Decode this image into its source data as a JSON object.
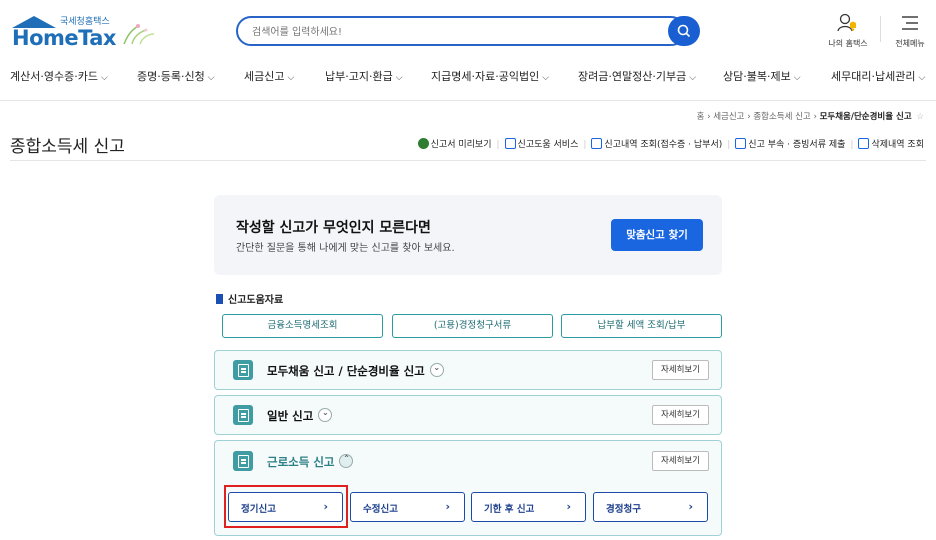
{
  "header": {
    "logo_sub": "국세청홈택스",
    "logo_brand": "HomeTax",
    "search_placeholder": "검색어를 입력하세요!",
    "my_hometax": "나의 홈택스",
    "all_menu": "전체메뉴"
  },
  "nav": [
    {
      "label": "계산서·영수증·카드"
    },
    {
      "label": "증명·등록·신청"
    },
    {
      "label": "세금신고"
    },
    {
      "label": "납부·고지·환급"
    },
    {
      "label": "지급명세·자료·공익법인"
    },
    {
      "label": "장려금·연말정산·기부금"
    },
    {
      "label": "상담·불복·제보"
    },
    {
      "label": "세무대리·납세관리"
    }
  ],
  "breadcrumb": {
    "home": "홈",
    "level1": "세금신고",
    "level2": "종합소득세 신고",
    "current": "모두채움/단순경비율 신고"
  },
  "page_title": "종합소득세 신고",
  "util_links": {
    "preview": "신고서 미리보기",
    "help_service": "신고도움 서비스",
    "history": "신고내역 조회(접수증 · 납부서)",
    "attach": "신고 부속 · 증빙서류 제출",
    "deleted": "삭제내역 조회"
  },
  "guide": {
    "title": "작성할 신고가 무엇인지 모른다면",
    "desc": "간단한 질문을 통해 나에게 맞는 신고를 찾아 보세요.",
    "button": "맞춤신고 찾기"
  },
  "help_section": {
    "heading": "신고도움자료",
    "buttons": [
      "금융소득명세조회",
      "(고용)경정청구서류",
      "납부할 세액 조회/납부"
    ]
  },
  "accordions": [
    {
      "title": "모두채움 신고 / 단순경비율 신고",
      "toggle": "⌄",
      "detail": "자세히보기"
    },
    {
      "title": "일반 신고",
      "toggle": "⌄",
      "detail": "자세히보기"
    },
    {
      "title": "근로소득 신고",
      "toggle": "⌃",
      "detail": "자세히보기"
    }
  ],
  "sub_buttons": [
    "정기신고",
    "수정신고",
    "기한 후 신고",
    "경정청구"
  ],
  "colors": {
    "brand": "#1f6fb8",
    "accent_blue": "#1a66e0",
    "teal": "#3e9ca2",
    "highlight_red": "#e0201e"
  }
}
